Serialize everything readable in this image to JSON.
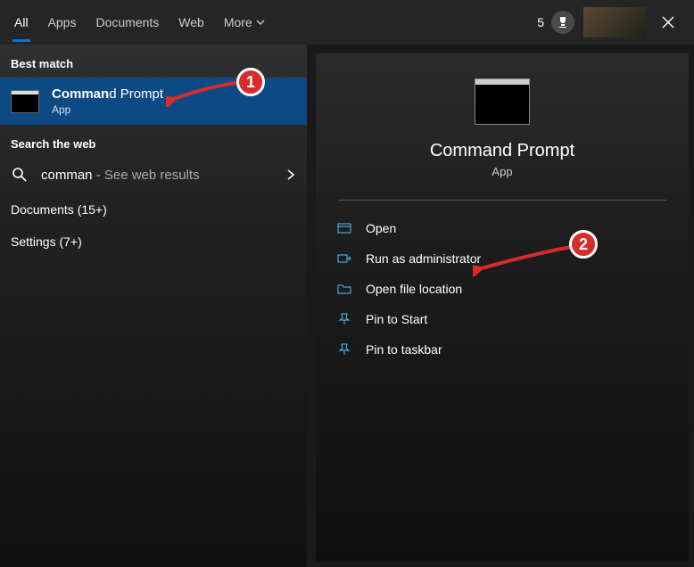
{
  "top": {
    "tabs": [
      "All",
      "Apps",
      "Documents",
      "Web",
      "More"
    ],
    "rewards_count": "5"
  },
  "left": {
    "best_match_header": "Best match",
    "best_match": {
      "title_bold": "Comman",
      "title_rest": "d Prompt",
      "subtitle": "App"
    },
    "search_web_header": "Search the web",
    "web": {
      "query": "comman",
      "suffix": " - See web results"
    },
    "categories": {
      "documents": "Documents (15+)",
      "settings": "Settings (7+)"
    }
  },
  "right": {
    "title": "Command Prompt",
    "subtitle": "App",
    "actions": {
      "open": "Open",
      "run_admin": "Run as administrator",
      "open_loc": "Open file location",
      "pin_start": "Pin to Start",
      "pin_taskbar": "Pin to taskbar"
    }
  },
  "annotations": {
    "one": "1",
    "two": "2"
  }
}
